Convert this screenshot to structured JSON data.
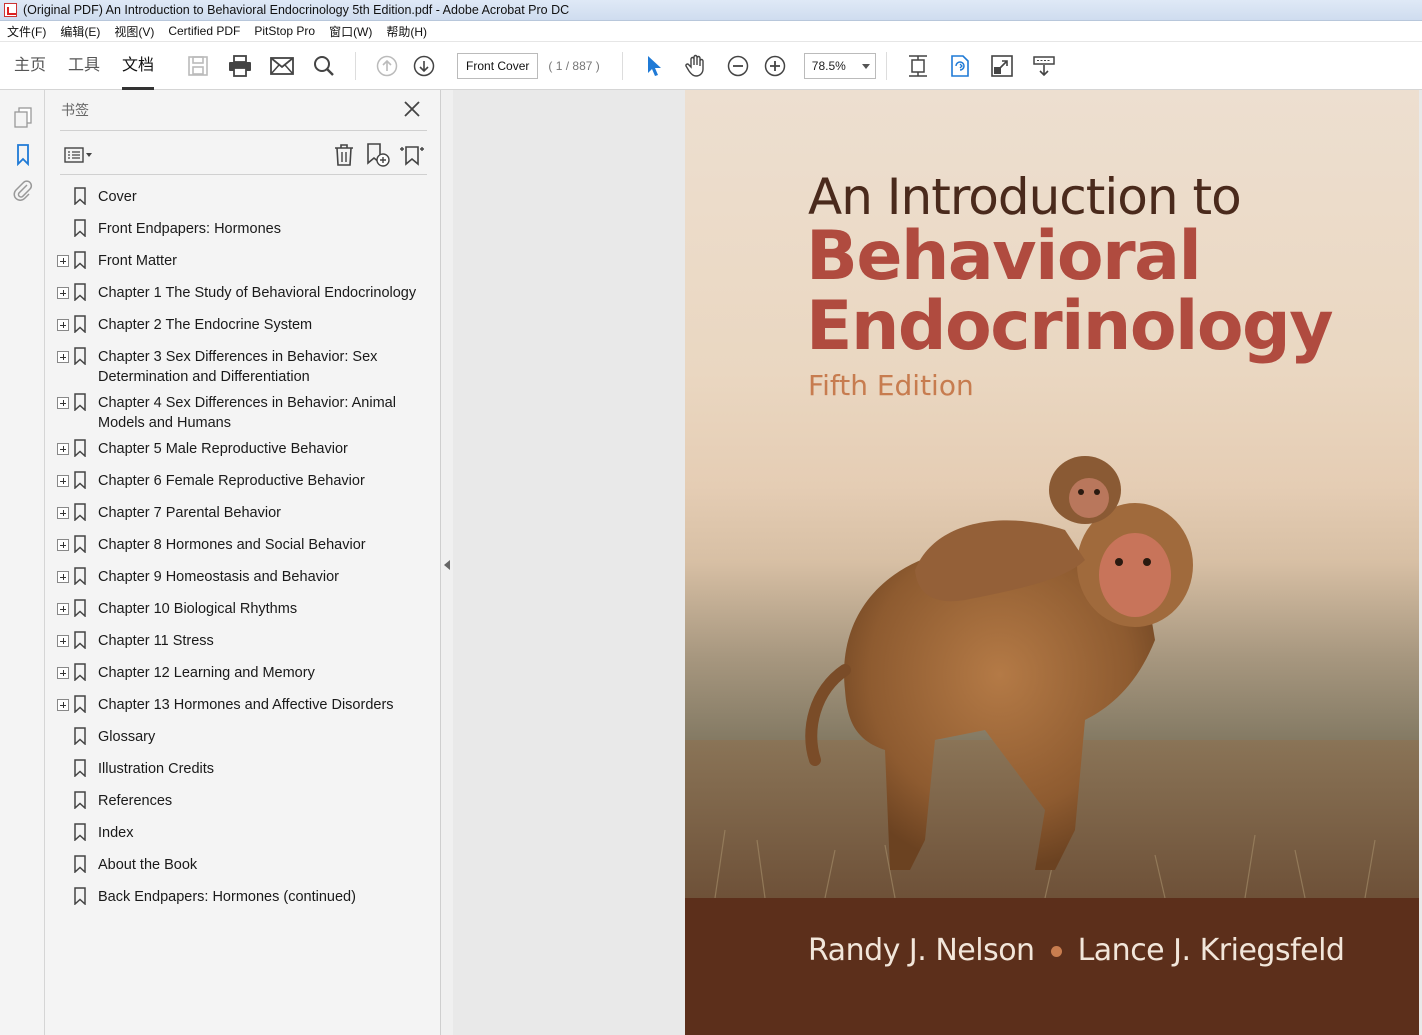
{
  "window": {
    "title": "(Original PDF) An Introduction to Behavioral Endocrinology 5th Edition.pdf - Adobe Acrobat Pro DC"
  },
  "menubar": {
    "items": [
      "文件(F)",
      "编辑(E)",
      "视图(V)",
      "Certified PDF",
      "PitStop Pro",
      "窗口(W)",
      "帮助(H)"
    ]
  },
  "toolbar": {
    "tabs": [
      "主页",
      "工具",
      "文档"
    ],
    "active_tab": "文档",
    "page_label": "Front Cover",
    "page_count": "( 1 / 887 )",
    "zoom": "78.5%"
  },
  "bookmarks_panel": {
    "title": "书签",
    "items": [
      {
        "label": "Cover",
        "expandable": false
      },
      {
        "label": "Front Endpapers: Hormones",
        "expandable": false
      },
      {
        "label": "Front Matter",
        "expandable": true
      },
      {
        "label": "Chapter 1 The Study of Behavioral Endocrinology",
        "expandable": true
      },
      {
        "label": "Chapter 2 The Endocrine System",
        "expandable": true
      },
      {
        "label": "Chapter 3 Sex Differences in Behavior: Sex Determination and Differentiation",
        "expandable": true
      },
      {
        "label": "Chapter 4 Sex Differences in Behavior: Animal Models and Humans",
        "expandable": true
      },
      {
        "label": "Chapter 5 Male Reproductive Behavior",
        "expandable": true
      },
      {
        "label": "Chapter 6 Female Reproductive Behavior",
        "expandable": true
      },
      {
        "label": "Chapter 7 Parental Behavior",
        "expandable": true
      },
      {
        "label": "Chapter 8 Hormones and Social Behavior",
        "expandable": true
      },
      {
        "label": "Chapter 9 Homeostasis and Behavior",
        "expandable": true
      },
      {
        "label": "Chapter 10 Biological Rhythms",
        "expandable": true
      },
      {
        "label": "Chapter 11 Stress",
        "expandable": true
      },
      {
        "label": "Chapter 12 Learning and Memory",
        "expandable": true
      },
      {
        "label": "Chapter 13 Hormones and Affective Disorders",
        "expandable": true
      },
      {
        "label": "Glossary",
        "expandable": false
      },
      {
        "label": "Illustration Credits",
        "expandable": false
      },
      {
        "label": "References",
        "expandable": false
      },
      {
        "label": "Index",
        "expandable": false
      },
      {
        "label": "About the Book",
        "expandable": false
      },
      {
        "label": "Back Endpapers: Hormones (continued)",
        "expandable": false
      }
    ]
  },
  "cover": {
    "title_line1": "An Introduction to",
    "title_line2": "Behavioral",
    "title_line3": "Endocrinology",
    "edition": "Fifth Edition",
    "author1": "Randy J. Nelson",
    "author2": "Lance J. Kriegsfeld"
  },
  "icons": [
    "save-icon",
    "print-icon",
    "email-icon",
    "search-icon",
    "page-up-icon",
    "page-down-icon",
    "select-arrow-icon",
    "hand-icon",
    "zoom-out-icon",
    "zoom-in-icon",
    "fit-page-icon",
    "rotate-icon",
    "fullscreen-icon",
    "read-mode-icon",
    "pages-icon",
    "bookmark-icon",
    "attachment-icon",
    "close-icon",
    "options-icon",
    "delete-icon",
    "new-bookmark-icon",
    "expand-bookmark-icon"
  ],
  "colors": {
    "title_dark": "#4a2a1c",
    "title_red": "#b04b3f",
    "edition": "#c77c4f",
    "band": "#5c2f1b",
    "selection_blue": "#1f7ad6"
  }
}
